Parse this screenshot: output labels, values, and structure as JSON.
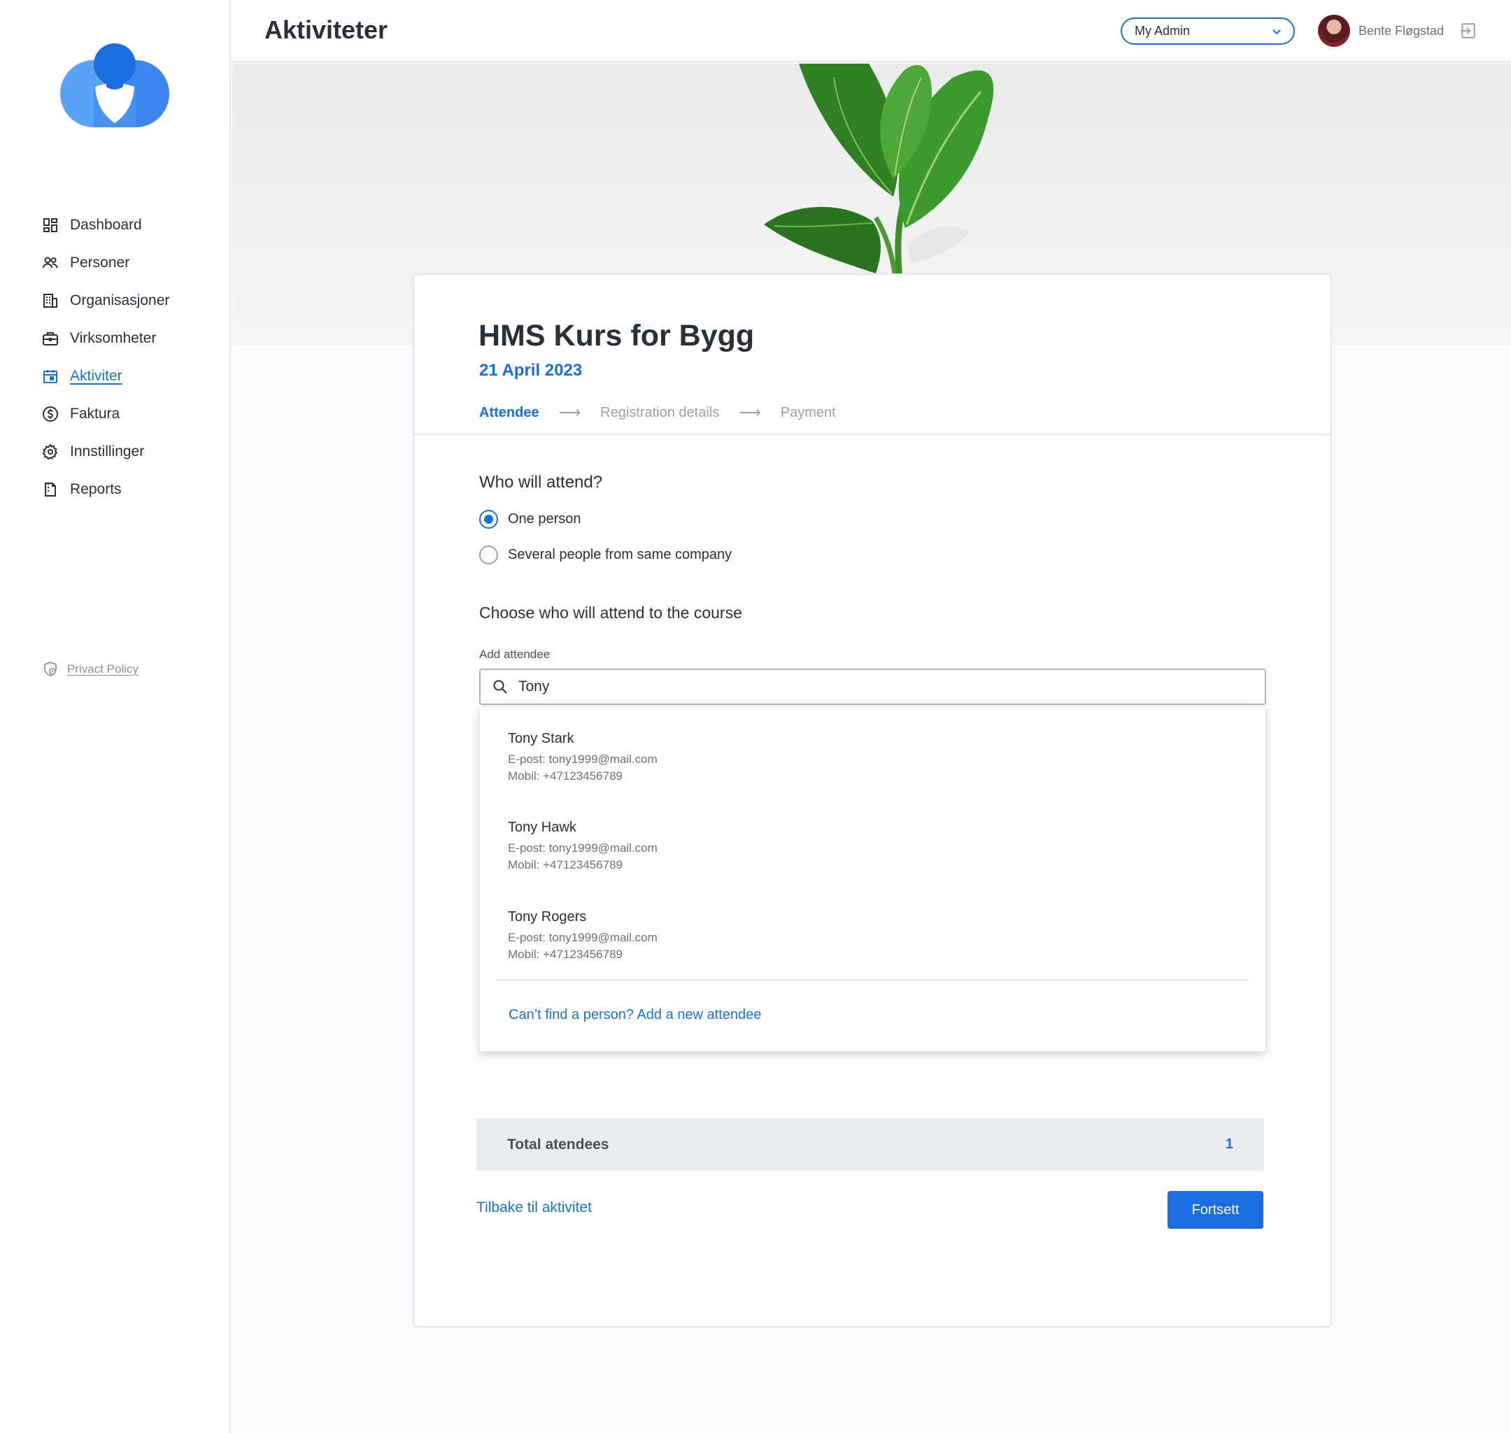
{
  "sidebar": {
    "logo": "heart-cloud-logo",
    "items": [
      {
        "label": "Dashboard",
        "icon": "dashboard-icon"
      },
      {
        "label": "Personer",
        "icon": "people-icon"
      },
      {
        "label": "Organisasjoner",
        "icon": "building-icon"
      },
      {
        "label": "Virksomheter",
        "icon": "briefcase-icon"
      },
      {
        "label": "Aktiviter",
        "icon": "calendar-icon",
        "active": true
      },
      {
        "label": "Faktura",
        "icon": "dollar-circle-icon"
      },
      {
        "label": "Innstillinger",
        "icon": "gear-icon"
      },
      {
        "label": "Reports",
        "icon": "report-icon"
      }
    ],
    "privacy_label": "Privact Policy"
  },
  "header": {
    "title": "Aktiviteter",
    "admin_select": "My Admin",
    "user_name": "Bente Fløgstad"
  },
  "course": {
    "title": "HMS Kurs for Bygg",
    "date": "21 April 2023",
    "steps": [
      "Attendee",
      "Registration details",
      "Payment"
    ],
    "arrow": "⟶"
  },
  "form": {
    "question": "Who will attend?",
    "options": [
      "One person",
      "Several people from same company"
    ],
    "selected_option": "One person",
    "choose_title": "Choose who will attend to the course",
    "field_label": "Add attendee",
    "search_value": "Tony"
  },
  "results": [
    {
      "name": "Tony Stark",
      "email": "E-post: tony1999@mail.com",
      "mobile": "Mobil: +47123456789"
    },
    {
      "name": "Tony Hawk",
      "email": "E-post: tony1999@mail.com",
      "mobile": "Mobil: +47123456789"
    },
    {
      "name": "Tony Rogers",
      "email": "E-post: tony1999@mail.com",
      "mobile": "Mobil: +47123456789"
    }
  ],
  "add_new_label": "Can’t find a person? Add a new attendee",
  "total": {
    "label": "Total atendees",
    "value": "1"
  },
  "actions": {
    "back_label": "Tilbake til aktivitet",
    "continue_label": "Fortsett"
  },
  "colors": {
    "accent": "#1a6fe0",
    "text": "#2b2f36",
    "muted": "#6b7078"
  }
}
